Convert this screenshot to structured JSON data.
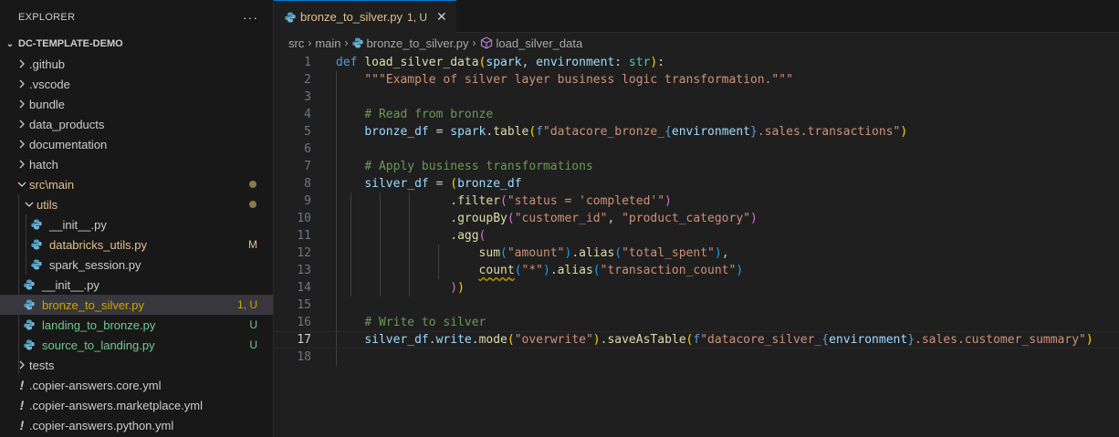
{
  "explorer": {
    "title": "EXPLORER",
    "more": "···",
    "project": "DC-TEMPLATE-DEMO",
    "items": [
      {
        "label": ".github",
        "type": "folder",
        "depth": 0
      },
      {
        "label": ".vscode",
        "type": "folder",
        "depth": 0
      },
      {
        "label": "bundle",
        "type": "folder",
        "depth": 0
      },
      {
        "label": "data_products",
        "type": "folder",
        "depth": 0
      },
      {
        "label": "documentation",
        "type": "folder",
        "depth": 0
      },
      {
        "label": "hatch",
        "type": "folder",
        "depth": 0
      },
      {
        "label": "src\\main",
        "type": "folder-open",
        "depth": 0
      },
      {
        "label": "utils",
        "type": "folder-open",
        "depth": 1
      },
      {
        "label": "__init__.py",
        "type": "py",
        "depth": 2
      },
      {
        "label": "databricks_utils.py",
        "type": "py",
        "depth": 2,
        "status": "M"
      },
      {
        "label": "spark_session.py",
        "type": "py",
        "depth": 2
      },
      {
        "label": "__init__.py",
        "type": "py",
        "depth": 1
      },
      {
        "label": "bronze_to_silver.py",
        "type": "py",
        "depth": 1,
        "status": "1, U"
      },
      {
        "label": "landing_to_bronze.py",
        "type": "py",
        "depth": 1,
        "status": "U"
      },
      {
        "label": "source_to_landing.py",
        "type": "py",
        "depth": 1,
        "status": "U"
      },
      {
        "label": "tests",
        "type": "folder",
        "depth": 0
      },
      {
        "label": ".copier-answers.core.yml",
        "type": "yml",
        "depth": 0
      },
      {
        "label": ".copier-answers.marketplace.yml",
        "type": "yml",
        "depth": 0
      },
      {
        "label": ".copier-answers.python.yml",
        "type": "yml",
        "depth": 0
      }
    ]
  },
  "tab": {
    "name": "bronze_to_silver.py",
    "status": "1, U",
    "close": "✕"
  },
  "breadcrumb": {
    "part1": "src",
    "part2": "main",
    "part3": "bronze_to_silver.py",
    "part4": "load_silver_data"
  },
  "code": {
    "line_numbers": [
      "1",
      "2",
      "3",
      "4",
      "5",
      "6",
      "7",
      "8",
      "9",
      "10",
      "11",
      "12",
      "13",
      "14",
      "15",
      "16",
      "17",
      "18"
    ],
    "current_line": 17
  },
  "colors": {
    "accent": "#0078d4",
    "modified": "#e2c08d",
    "untracked": "#73c991",
    "python_icon": "#519aba"
  }
}
